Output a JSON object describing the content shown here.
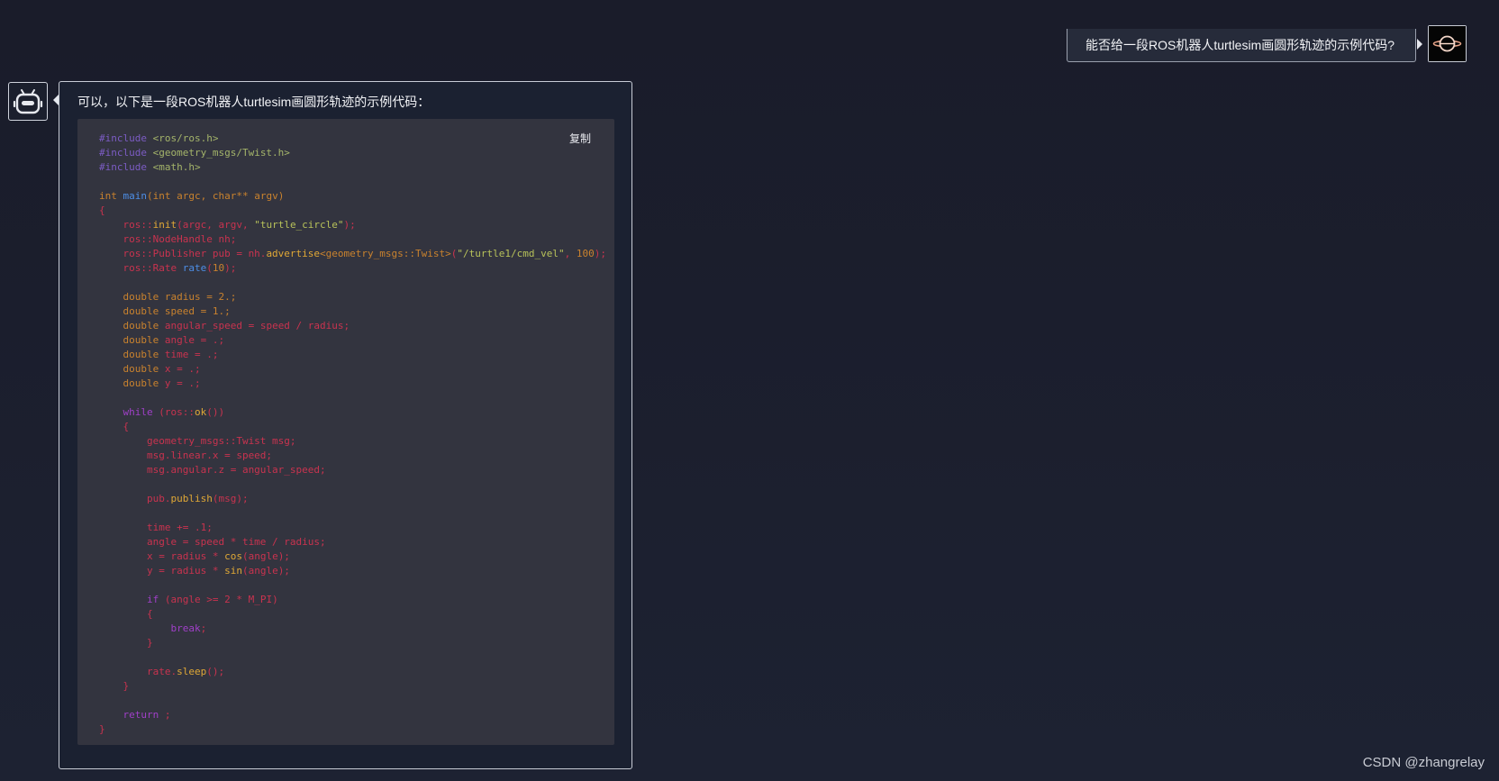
{
  "user": {
    "message": "能否给一段ROS机器人turtlesim画圆形轨迹的示例代码?",
    "avatar_icon": "black-hole-icon"
  },
  "bot": {
    "avatar_icon": "robot-icon",
    "intro": "可以，以下是一段ROS机器人turtlesim画圆形轨迹的示例代码：",
    "copy_label": "复制",
    "code_lines": [
      [
        [
          "pre",
          "#include"
        ],
        [
          "inc",
          " <ros/ros.h>"
        ]
      ],
      [
        [
          "pre",
          "#include"
        ],
        [
          "inc",
          " <geometry_msgs/Twist.h>"
        ]
      ],
      [
        [
          "pre",
          "#include"
        ],
        [
          "inc",
          " <math.h>"
        ]
      ],
      [],
      [
        [
          "kw",
          "int"
        ],
        [
          "id",
          " "
        ],
        [
          "fn",
          "main"
        ],
        [
          "kw",
          "(int argc, char** argv)"
        ]
      ],
      [
        [
          "id",
          "{"
        ]
      ],
      [
        [
          "id",
          "    ros::"
        ],
        [
          "call",
          "init"
        ],
        [
          "id",
          "(argc, argv, "
        ],
        [
          "str",
          "\"turtle_circle\""
        ],
        [
          "id",
          ");"
        ]
      ],
      [
        [
          "id",
          "    ros::NodeHandle nh;"
        ]
      ],
      [
        [
          "id",
          "    ros::Publisher pub = nh."
        ],
        [
          "call",
          "advertise"
        ],
        [
          "kw",
          "<geometry_msgs::Twist>"
        ],
        [
          "id",
          "("
        ],
        [
          "str",
          "\"/turtle1/cmd_vel\""
        ],
        [
          "id",
          ", "
        ],
        [
          "num",
          "100"
        ],
        [
          "id",
          ");"
        ]
      ],
      [
        [
          "id",
          "    ros::Rate "
        ],
        [
          "fn",
          "rate"
        ],
        [
          "id",
          "("
        ],
        [
          "num",
          "10"
        ],
        [
          "id",
          ");"
        ]
      ],
      [],
      [
        [
          "kw",
          "    double radius = 2.;"
        ]
      ],
      [
        [
          "kw",
          "    double speed = 1.;"
        ]
      ],
      [
        [
          "kw",
          "    double "
        ],
        [
          "id",
          "angular_speed = speed / radius;"
        ]
      ],
      [
        [
          "kw",
          "    double "
        ],
        [
          "id",
          "angle = .;"
        ]
      ],
      [
        [
          "kw",
          "    double "
        ],
        [
          "id",
          "time = .;"
        ]
      ],
      [
        [
          "kw",
          "    double "
        ],
        [
          "id",
          "x = .;"
        ]
      ],
      [
        [
          "kw",
          "    double "
        ],
        [
          "id",
          "y = .;"
        ]
      ],
      [],
      [
        [
          "ctl",
          "    while"
        ],
        [
          "id",
          " (ros::"
        ],
        [
          "call",
          "ok"
        ],
        [
          "id",
          "())"
        ]
      ],
      [
        [
          "id",
          "    {"
        ]
      ],
      [
        [
          "id",
          "        geometry_msgs::Twist msg;"
        ]
      ],
      [
        [
          "id",
          "        msg.linear.x = speed;"
        ]
      ],
      [
        [
          "id",
          "        msg.angular.z = angular_speed;"
        ]
      ],
      [],
      [
        [
          "id",
          "        pub."
        ],
        [
          "call",
          "publish"
        ],
        [
          "id",
          "(msg);"
        ]
      ],
      [],
      [
        [
          "id",
          "        time += .1;"
        ]
      ],
      [
        [
          "id",
          "        angle = speed * time / radius;"
        ]
      ],
      [
        [
          "id",
          "        x = radius * "
        ],
        [
          "call",
          "cos"
        ],
        [
          "id",
          "(angle);"
        ]
      ],
      [
        [
          "id",
          "        y = radius * "
        ],
        [
          "call",
          "sin"
        ],
        [
          "id",
          "(angle);"
        ]
      ],
      [],
      [
        [
          "ctl",
          "        if"
        ],
        [
          "id",
          " (angle >= 2 * M_PI)"
        ]
      ],
      [
        [
          "id",
          "        {"
        ]
      ],
      [
        [
          "ctl",
          "            break"
        ],
        [
          "id",
          ";"
        ]
      ],
      [
        [
          "id",
          "        }"
        ]
      ],
      [],
      [
        [
          "id",
          "        rate."
        ],
        [
          "call",
          "sleep"
        ],
        [
          "id",
          "();"
        ]
      ],
      [
        [
          "id",
          "    }"
        ]
      ],
      [],
      [
        [
          "ctl",
          "    return"
        ],
        [
          "id",
          " ;"
        ]
      ],
      [
        [
          "id",
          "}"
        ]
      ]
    ]
  },
  "watermark": "CSDN @zhangrelay"
}
